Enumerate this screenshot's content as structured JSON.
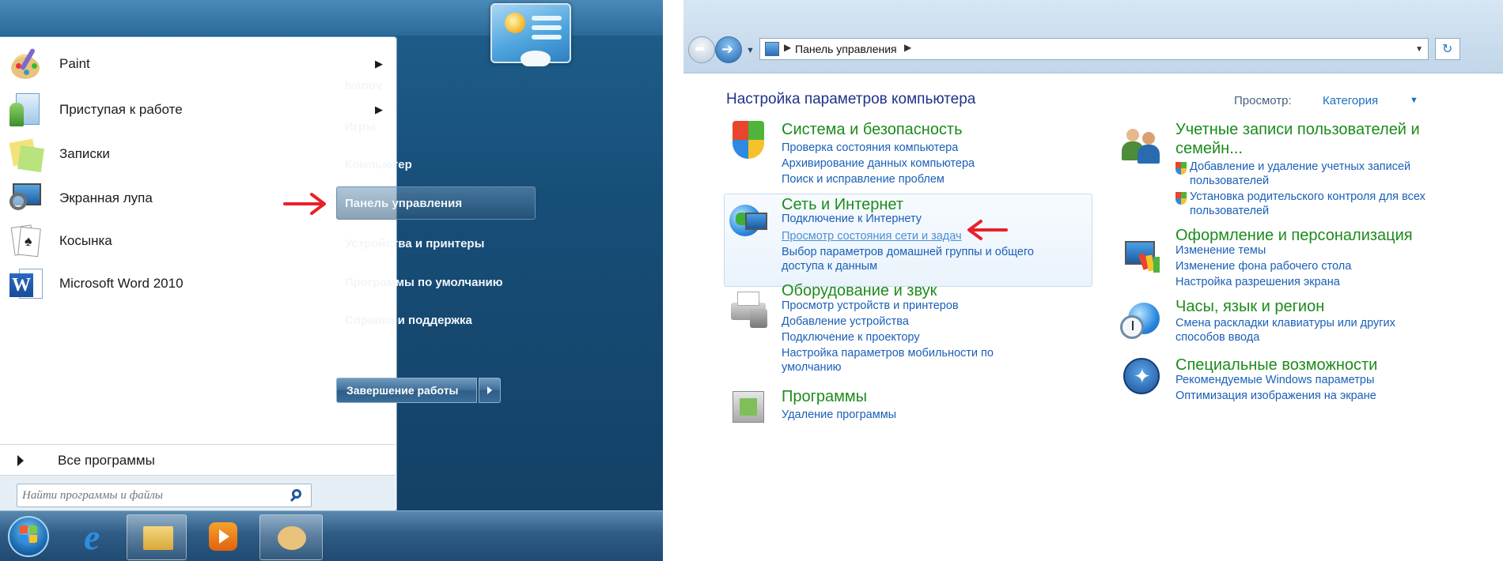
{
  "start_menu": {
    "programs": [
      {
        "label": "Paint",
        "icon": "paint-icon",
        "has_submenu": true
      },
      {
        "label": "Приступая к работе",
        "icon": "getting-started-icon",
        "has_submenu": true
      },
      {
        "label": "Записки",
        "icon": "sticky-notes-icon",
        "has_submenu": false
      },
      {
        "label": "Экранная лупа",
        "icon": "magnifier-icon",
        "has_submenu": false
      },
      {
        "label": "Косынка",
        "icon": "solitaire-icon",
        "has_submenu": false
      },
      {
        "label": "Microsoft Word 2010",
        "icon": "word-icon",
        "has_submenu": false
      }
    ],
    "all_programs": "Все программы",
    "search_placeholder": "Найти программы и файлы",
    "right_items": [
      "Ivanov",
      "Игры",
      "Компьютер",
      "Панель управления",
      "Устройства и принтеры",
      "Программы по умолчанию",
      "Справка и поддержка"
    ],
    "highlighted_item": "Панель управления",
    "shutdown_label": "Завершение работы"
  },
  "taskbar": {
    "items": [
      "start-orb",
      "internet-explorer",
      "windows-explorer",
      "media-player",
      "paint"
    ]
  },
  "control_panel": {
    "address": "Панель управления",
    "title": "Настройка параметров компьютера",
    "view_label": "Просмотр:",
    "view_value": "Категория",
    "categories": [
      {
        "id": "system",
        "title": "Система и безопасность",
        "icon": "shield-icon",
        "links": [
          "Проверка состояния компьютера",
          "Архивирование данных компьютера",
          "Поиск и исправление проблем"
        ]
      },
      {
        "id": "network",
        "title": "Сеть и Интернет",
        "icon": "network-globe-icon",
        "links": [
          "Подключение к Интернету",
          "Просмотр состояния сети и задач",
          "Выбор параметров домашней группы и общего",
          "доступа к данным"
        ]
      },
      {
        "id": "hardware",
        "title": "Оборудование и звук",
        "icon": "printer-icon",
        "links": [
          "Просмотр устройств и принтеров",
          "Добавление устройства",
          "Подключение к проектору",
          "Настройка параметров мобильности по",
          "умолчанию"
        ]
      },
      {
        "id": "programs",
        "title": "Программы",
        "icon": "programs-box-icon",
        "links": [
          "Удаление программы"
        ]
      },
      {
        "id": "users",
        "title": "Учетные записи пользователей и",
        "title2": "семейн...",
        "icon": "users-icon",
        "links": [
          "Добавление и удаление учетных записей",
          "пользователей",
          "Установка родительского контроля для всех",
          "пользователей"
        ]
      },
      {
        "id": "appearance",
        "title": "Оформление и персонализация",
        "icon": "appearance-icon",
        "links": [
          "Изменение темы",
          "Изменение фона рабочего стола",
          "Настройка разрешения экрана"
        ]
      },
      {
        "id": "clock",
        "title": "Часы, язык и регион",
        "icon": "clock-globe-icon",
        "links": [
          "Смена раскладки клавиатуры или других",
          "способов ввода"
        ]
      },
      {
        "id": "access",
        "title": "Специальные возможности",
        "icon": "accessibility-icon",
        "links": [
          "Рекомендуемые Windows параметры",
          "Оптимизация изображения на экране"
        ]
      }
    ]
  },
  "colors": {
    "category_title": "#1c8b1c",
    "link": "#1a5fb8",
    "annotation_arrow": "#e8202a"
  }
}
